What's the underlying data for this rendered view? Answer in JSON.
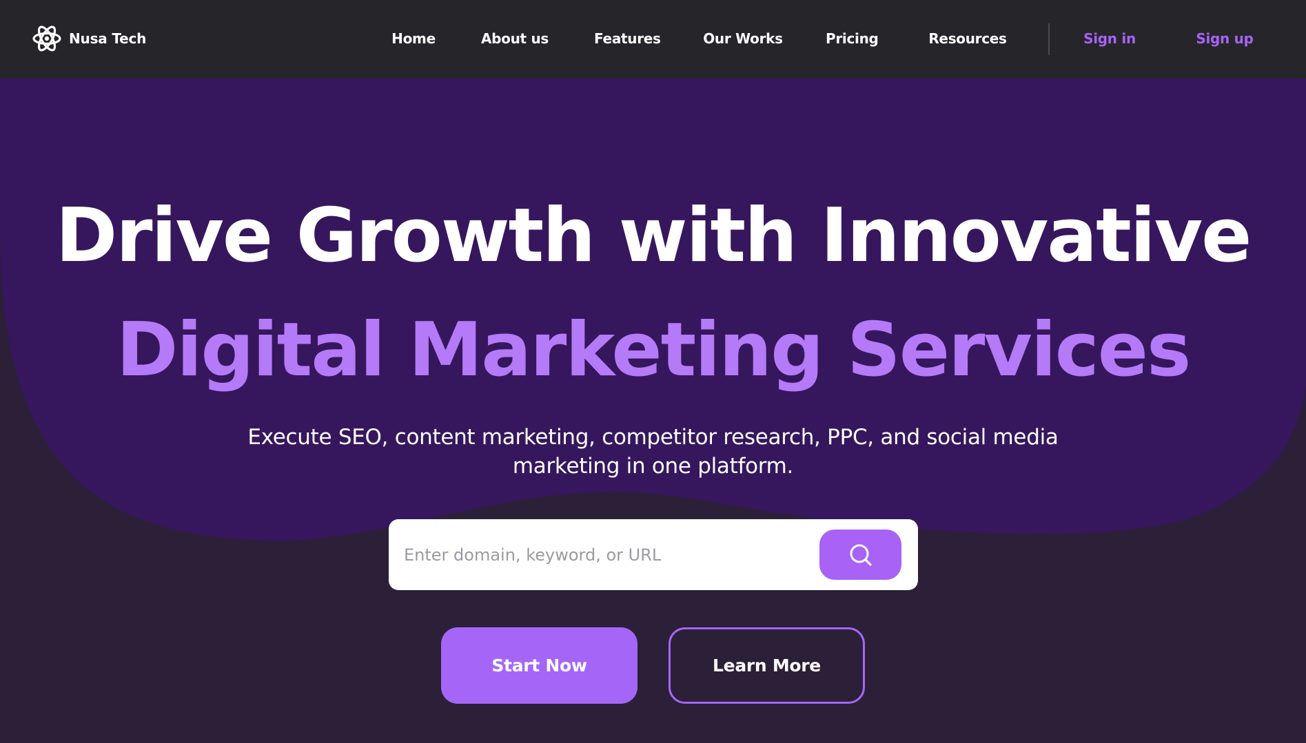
{
  "brand": {
    "name": "Nusa Tech",
    "logo_icon": "atom-icon"
  },
  "nav": {
    "links": [
      {
        "label": "Home"
      },
      {
        "label": "About us"
      },
      {
        "label": "Features"
      },
      {
        "label": "Our Works"
      },
      {
        "label": "Pricing"
      },
      {
        "label": "Resources"
      }
    ],
    "sign_in": "Sign in",
    "sign_up": "Sign up"
  },
  "hero": {
    "headline_line1": "Drive Growth with Innovative",
    "headline_line2": "Digital Marketing Services",
    "subtitle": "Execute SEO, content marketing, competitor research, PPC, and social media marketing in one platform."
  },
  "search": {
    "placeholder": "Enter domain, keyword, or URL",
    "value": "",
    "button_icon": "search-icon"
  },
  "cta": {
    "primary_label": "Start Now",
    "secondary_label": "Learn More"
  },
  "colors": {
    "nav_background": "#262529",
    "page_background": "#2c1f38",
    "hero_blob": "#36175d",
    "accent": "#a863f5",
    "headline_accent": "#b57af7",
    "text_light": "#ffffff"
  }
}
